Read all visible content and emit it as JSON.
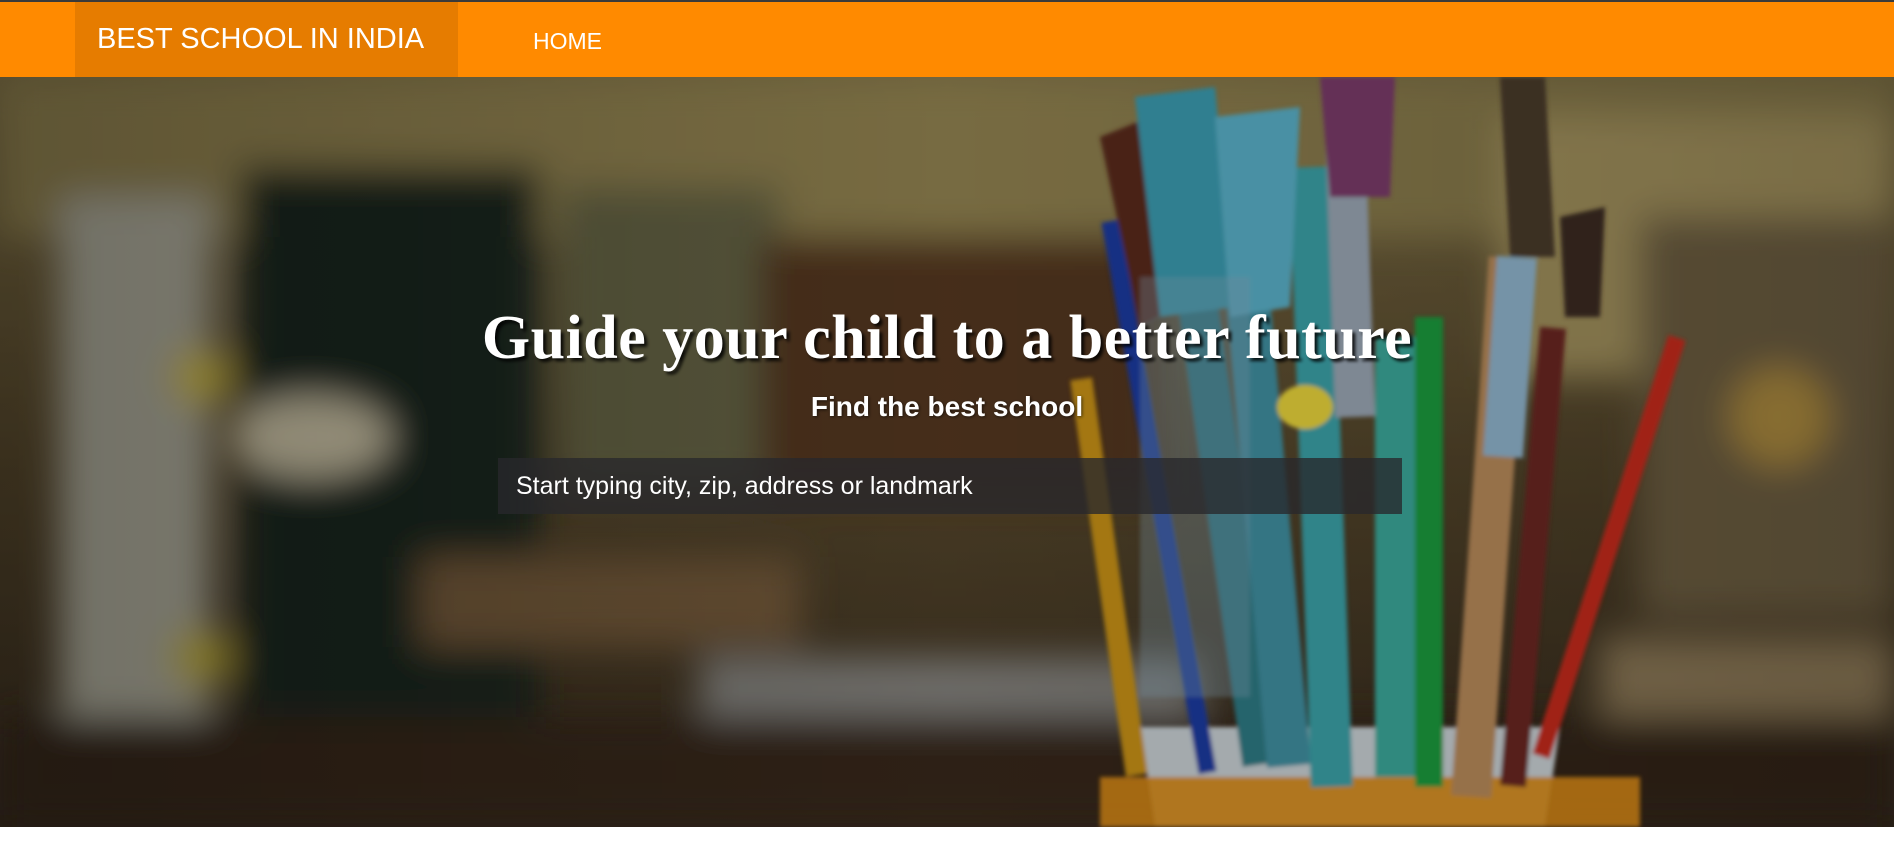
{
  "navbar": {
    "brand": "BEST SCHOOL IN INDIA",
    "links": [
      "HOME"
    ],
    "background_color": "#ff8a00",
    "brand_background_color": "#e67c00"
  },
  "hero": {
    "title": "Guide your child to a better future",
    "subtitle": "Find the best school",
    "search": {
      "placeholder": "Start typing city, zip, address or landmark",
      "value": ""
    },
    "background_image": "blurred-classroom-with-paint-brushes-in-cup"
  }
}
